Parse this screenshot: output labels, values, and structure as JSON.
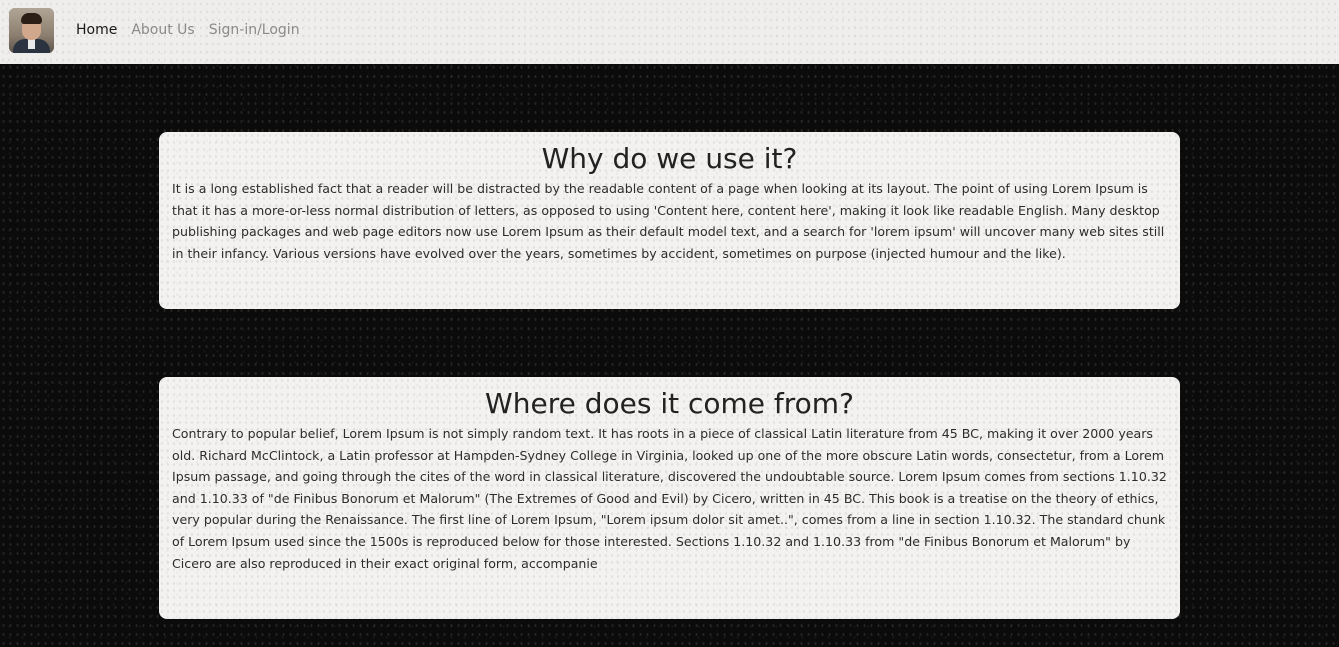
{
  "nav": {
    "items": [
      {
        "label": "Home",
        "active": true
      },
      {
        "label": "About Us",
        "active": false
      },
      {
        "label": "Sign-in/Login",
        "active": false
      }
    ]
  },
  "sections": [
    {
      "title": "Why do we use it?",
      "body": "It is a long established fact that a reader will be distracted by the readable content of a page when looking at its layout. The point of using Lorem Ipsum is that it has a more-or-less normal distribution of letters, as opposed to using 'Content here, content here', making it look like readable English. Many desktop publishing packages and web page editors now use Lorem Ipsum as their default model text, and a search for 'lorem ipsum' will uncover many web sites still in their infancy. Various versions have evolved over the years, sometimes by accident, sometimes on purpose (injected humour and the like)."
    },
    {
      "title": "Where does it come from?",
      "body": "Contrary to popular belief, Lorem Ipsum is not simply random text. It has roots in a piece of classical Latin literature from 45 BC, making it over 2000 years old. Richard McClintock, a Latin professor at Hampden-Sydney College in Virginia, looked up one of the more obscure Latin words, consectetur, from a Lorem Ipsum passage, and going through the cites of the word in classical literature, discovered the undoubtable source. Lorem Ipsum comes from sections 1.10.32 and 1.10.33 of \"de Finibus Bonorum et Malorum\" (The Extremes of Good and Evil) by Cicero, written in 45 BC. This book is a treatise on the theory of ethics, very popular during the Renaissance. The first line of Lorem Ipsum, \"Lorem ipsum dolor sit amet..\", comes from a line in section 1.10.32. The standard chunk of Lorem Ipsum used since the 1500s is reproduced below for those interested. Sections 1.10.32 and 1.10.33 from \"de Finibus Bonorum et Malorum\" by Cicero are also reproduced in their exact original form, accompanie"
    }
  ]
}
